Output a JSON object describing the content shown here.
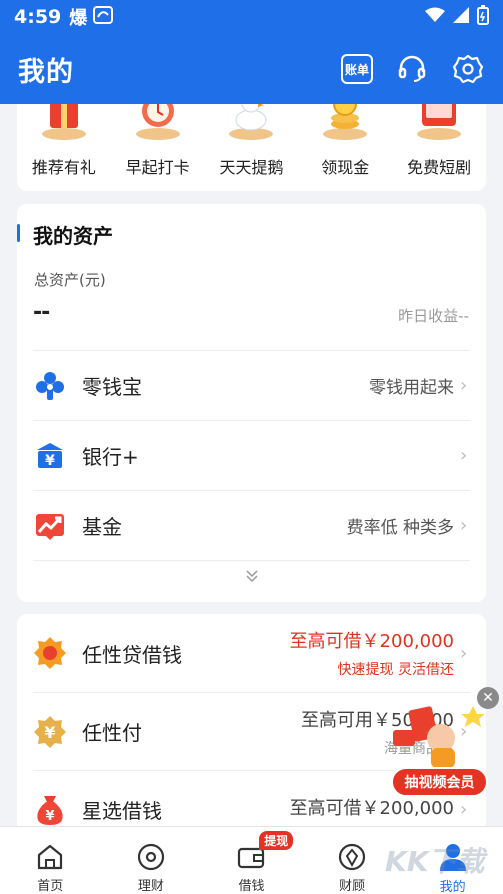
{
  "status_bar": {
    "time": "4:59",
    "extra": "爆"
  },
  "header": {
    "title": "我的",
    "bill_label": "账单"
  },
  "promos": [
    {
      "label": "推荐有礼",
      "icon": "gift-icon"
    },
    {
      "label": "早起打卡",
      "icon": "alarm-clock-icon"
    },
    {
      "label": "天天提鹅",
      "icon": "goose-icon"
    },
    {
      "label": "领现金",
      "icon": "cash-icon"
    },
    {
      "label": "免费短剧",
      "icon": "drama-icon"
    }
  ],
  "assets": {
    "title": "我的资产",
    "total_label": "总资产(元)",
    "total_value": "--",
    "yesterday_label": "昨日收益--",
    "rows": [
      {
        "name": "零钱宝",
        "desc": "零钱用起来"
      },
      {
        "name": "银行+",
        "desc": ""
      },
      {
        "name": "基金",
        "desc": "费率低 种类多"
      }
    ]
  },
  "loans": [
    {
      "name": "任性贷借钱",
      "amount": "至高可借￥200,000",
      "sub": "快速提现 灵活借还",
      "highlight": true
    },
    {
      "name": "任性付",
      "amount": "至高可用￥50,000",
      "sub": "海量商品享",
      "highlight": false
    },
    {
      "name": "星选借钱",
      "amount": "至高可借￥200,000",
      "sub": "",
      "highlight": false
    }
  ],
  "float_ad": {
    "label": "抽视频会员"
  },
  "nav": [
    {
      "label": "首页",
      "icon": "home-icon"
    },
    {
      "label": "理财",
      "icon": "finance-icon"
    },
    {
      "label": "借钱",
      "icon": "borrow-icon",
      "badge": "提现"
    },
    {
      "label": "财顾",
      "icon": "advisor-icon"
    },
    {
      "label": "我的",
      "icon": "profile-icon",
      "active": true
    }
  ],
  "watermark": "KK下载",
  "colors": {
    "brand": "#1e6fe8",
    "accent_red": "#e53222"
  }
}
